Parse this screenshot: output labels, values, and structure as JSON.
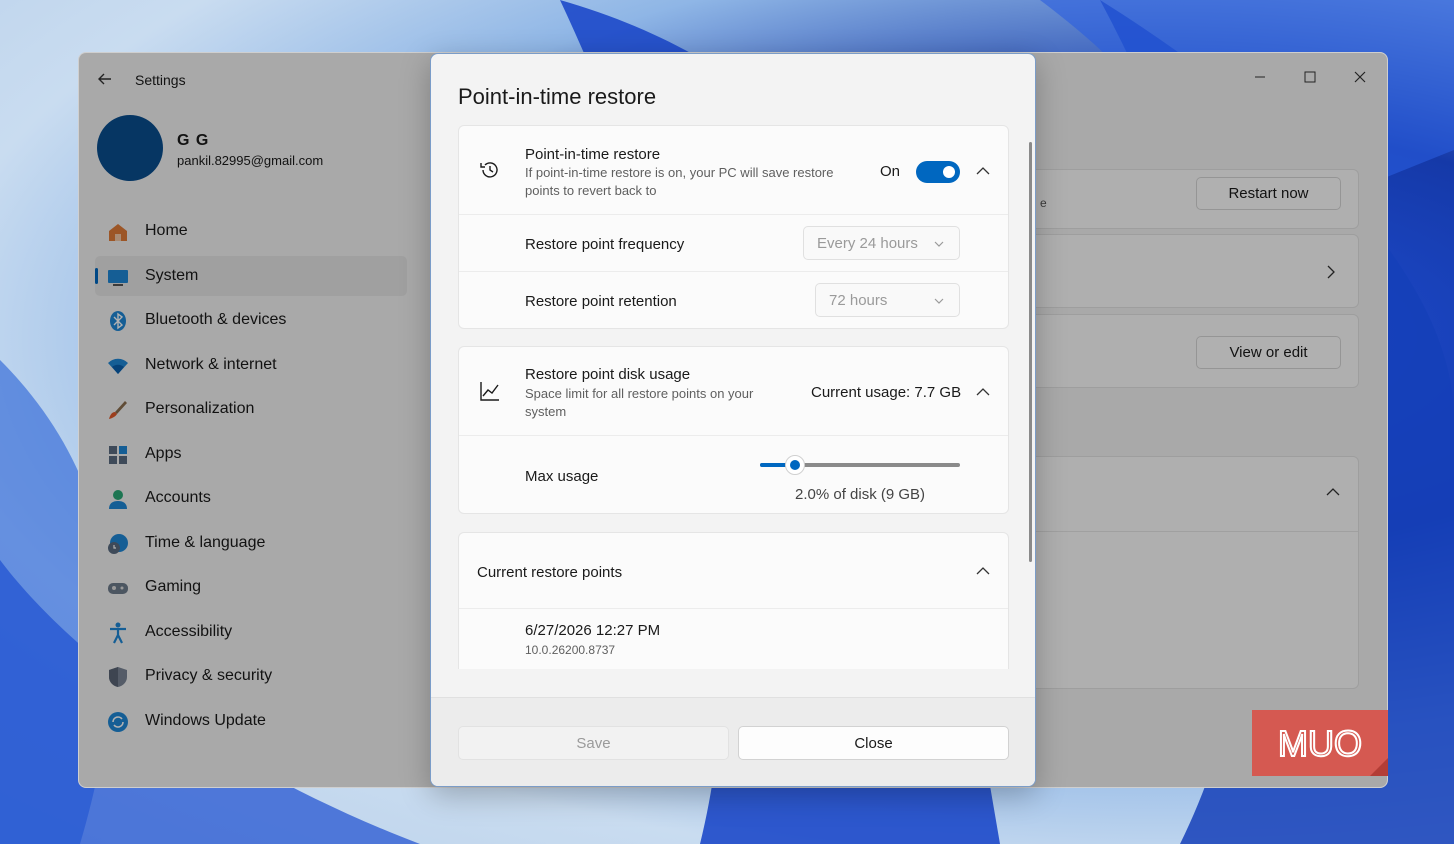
{
  "settings": {
    "window_title": "Settings",
    "user": {
      "name": "G G",
      "email": "pankil.82995@gmail.com"
    },
    "nav": [
      {
        "label": "Home",
        "icon": "home-icon"
      },
      {
        "label": "System",
        "icon": "system-icon",
        "selected": true
      },
      {
        "label": "Bluetooth & devices",
        "icon": "bluetooth-icon"
      },
      {
        "label": "Network & internet",
        "icon": "wifi-icon"
      },
      {
        "label": "Personalization",
        "icon": "brush-icon"
      },
      {
        "label": "Apps",
        "icon": "apps-icon"
      },
      {
        "label": "Accounts",
        "icon": "accounts-icon"
      },
      {
        "label": "Time & language",
        "icon": "globe-clock-icon"
      },
      {
        "label": "Gaming",
        "icon": "gamepad-icon"
      },
      {
        "label": "Accessibility",
        "icon": "accessibility-icon"
      },
      {
        "label": "Privacy & security",
        "icon": "shield-icon"
      },
      {
        "label": "Windows Update",
        "icon": "update-icon"
      }
    ],
    "background_partial_text": "e",
    "restart_label": "Restart now",
    "view_edit_label": "View or edit"
  },
  "dialog": {
    "title": "Point-in-time restore",
    "pitr": {
      "title": "Point-in-time restore",
      "description": "If point-in-time restore is on, your PC will save restore points to revert back to",
      "state_label": "On",
      "toggle_on": true
    },
    "frequency": {
      "label": "Restore point frequency",
      "value": "Every 24 hours"
    },
    "retention": {
      "label": "Restore point retention",
      "value": "72 hours"
    },
    "disk_usage": {
      "title": "Restore point disk usage",
      "description": "Space limit for all restore points on your system",
      "current": "Current usage: 7.7 GB"
    },
    "max_usage": {
      "label": "Max usage",
      "value_text": "2.0% of disk (9 GB)",
      "slider_percent": 2.0
    },
    "current_points": {
      "title": "Current restore points",
      "items": [
        {
          "date": "6/27/2026 12:27 PM",
          "version": "10.0.26200.8737"
        }
      ]
    },
    "save_label": "Save",
    "close_label": "Close"
  },
  "watermark": "MUO",
  "colors": {
    "accent": "#0067c0",
    "watermark_bg": "#d9534a"
  }
}
